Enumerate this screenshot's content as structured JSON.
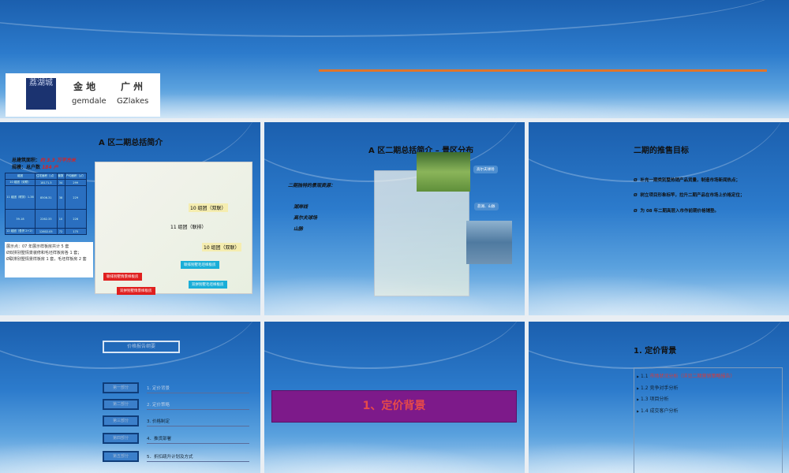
{
  "cover": {
    "logo_cn_1": "金 地",
    "logo_cn_2": "广 州",
    "logo_en_1": "gemdale",
    "logo_en_2": "GZlakes",
    "logo_mark": "荔湖城",
    "accent": "#e0742a"
  },
  "slide1": {
    "title": "A 区二期总括简介",
    "area_label": "总建筑面积：",
    "area_value": "约 3.3 万平方米",
    "scale_label": "规模：总户数",
    "scale_value": "184 户",
    "table": {
      "headers": [
        "组团",
        "住宅面积（㎡）",
        "套数",
        "户均面积（㎡）"
      ],
      "rows": [
        [
          "10 组团（双联）",
          "18171.3",
          "34",
          "299"
        ],
        [
          "11 组团（联排）1-38",
          "8506.31",
          "38",
          "229"
        ],
        [
          "39-18",
          "2262.33",
          "10",
          "226"
        ],
        [
          "12 组团（叠拼 2+2）",
          "12602.05",
          "72",
          "175"
        ]
      ]
    },
    "note_title": "展示点：07 年展示样板房共计 5 套",
    "note_1": "Ø双拼别墅情景装修和毛坯样板房各 1 套；",
    "note_2": "Ø联排别墅情景样板房 1 套，毛坯样板房 2 套",
    "map_labels": [
      "10 组团（双联）",
      "11 组团（联排）",
      "10 组团（双联）"
    ],
    "tags": [
      "联排别墅毛坯样板房",
      "联排别墅情景样板房",
      "双拼别墅毛坯样板房",
      "双拼别墅情景样板房"
    ]
  },
  "slide2": {
    "title": "A 区二期总括简介 – 景区分布",
    "subtitle": "二期独特的景观资源：",
    "items": [
      "湖岸线",
      "高尔夫球场",
      "山脉"
    ],
    "callouts": [
      "高尔夫球场",
      "荔湖、山脉"
    ]
  },
  "slide3": {
    "title": "二期的推售目标",
    "bullet": "Ø",
    "items": [
      "补充一期类别墅热销产品货量，制造市场新闻热点；",
      "树立项目形象标竿，拉升二期产品在市场上价格定位；",
      "为 08 年二期高层入市作前期价格铺垫。"
    ]
  },
  "slide4": {
    "title": "价格报告纲要",
    "parts": [
      {
        "part": "第一部分",
        "label": "1. 定价背景"
      },
      {
        "part": "第二部分",
        "label": "2. 定价策略"
      },
      {
        "part": "第三部分",
        "label": "3. 价格制定"
      },
      {
        "part": "第四部分",
        "label": "4．推货部署"
      },
      {
        "part": "第五部分",
        "label": "5．折扣疏升计划及方式"
      }
    ]
  },
  "slide5": {
    "title": "1、定价背景",
    "color": "#7d1a8a"
  },
  "slide6": {
    "title": "1. 定价背景",
    "items": [
      {
        "num": "1.1",
        "text": "市场状况分析（详见二期营销策略报告）"
      },
      {
        "num": "1.2",
        "text": "竞争对手分析"
      },
      {
        "num": "1.3",
        "text": "项目分析"
      },
      {
        "num": "1.4",
        "text": "成交客户分析"
      }
    ]
  }
}
